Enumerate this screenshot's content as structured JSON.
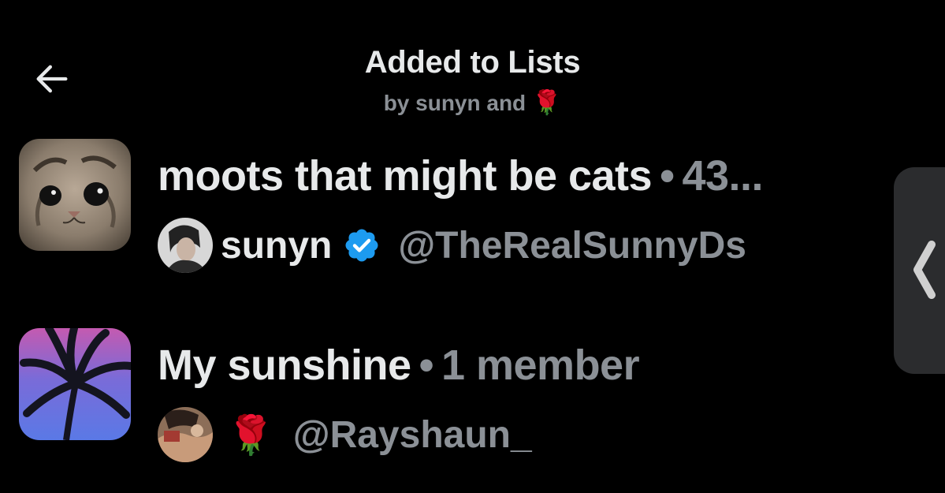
{
  "header": {
    "title": "Added to Lists",
    "subtitle_prefix": "by sunyn and",
    "subtitle_emoji": "🌹"
  },
  "lists": [
    {
      "name": "moots that might be cats",
      "separator": "•",
      "member_count": "43...",
      "owner": {
        "display_name": "sunyn",
        "verified": true,
        "handle": "@TheRealSunnyDs"
      }
    },
    {
      "name": "My sunshine",
      "separator": "•",
      "member_count": "1 member",
      "owner": {
        "display_name": "🌹",
        "verified": false,
        "handle": "@Rayshaun_"
      }
    }
  ],
  "icons": {
    "back": "arrow-left-icon",
    "verified": "verified-badge-icon",
    "side_handle": "chevron-left-icon"
  },
  "colors": {
    "background": "#000000",
    "primary_text": "#e7e9ea",
    "secondary_text": "#8b9096",
    "verified_blue": "#1d9bf0",
    "rose_red": "#d7142b"
  }
}
